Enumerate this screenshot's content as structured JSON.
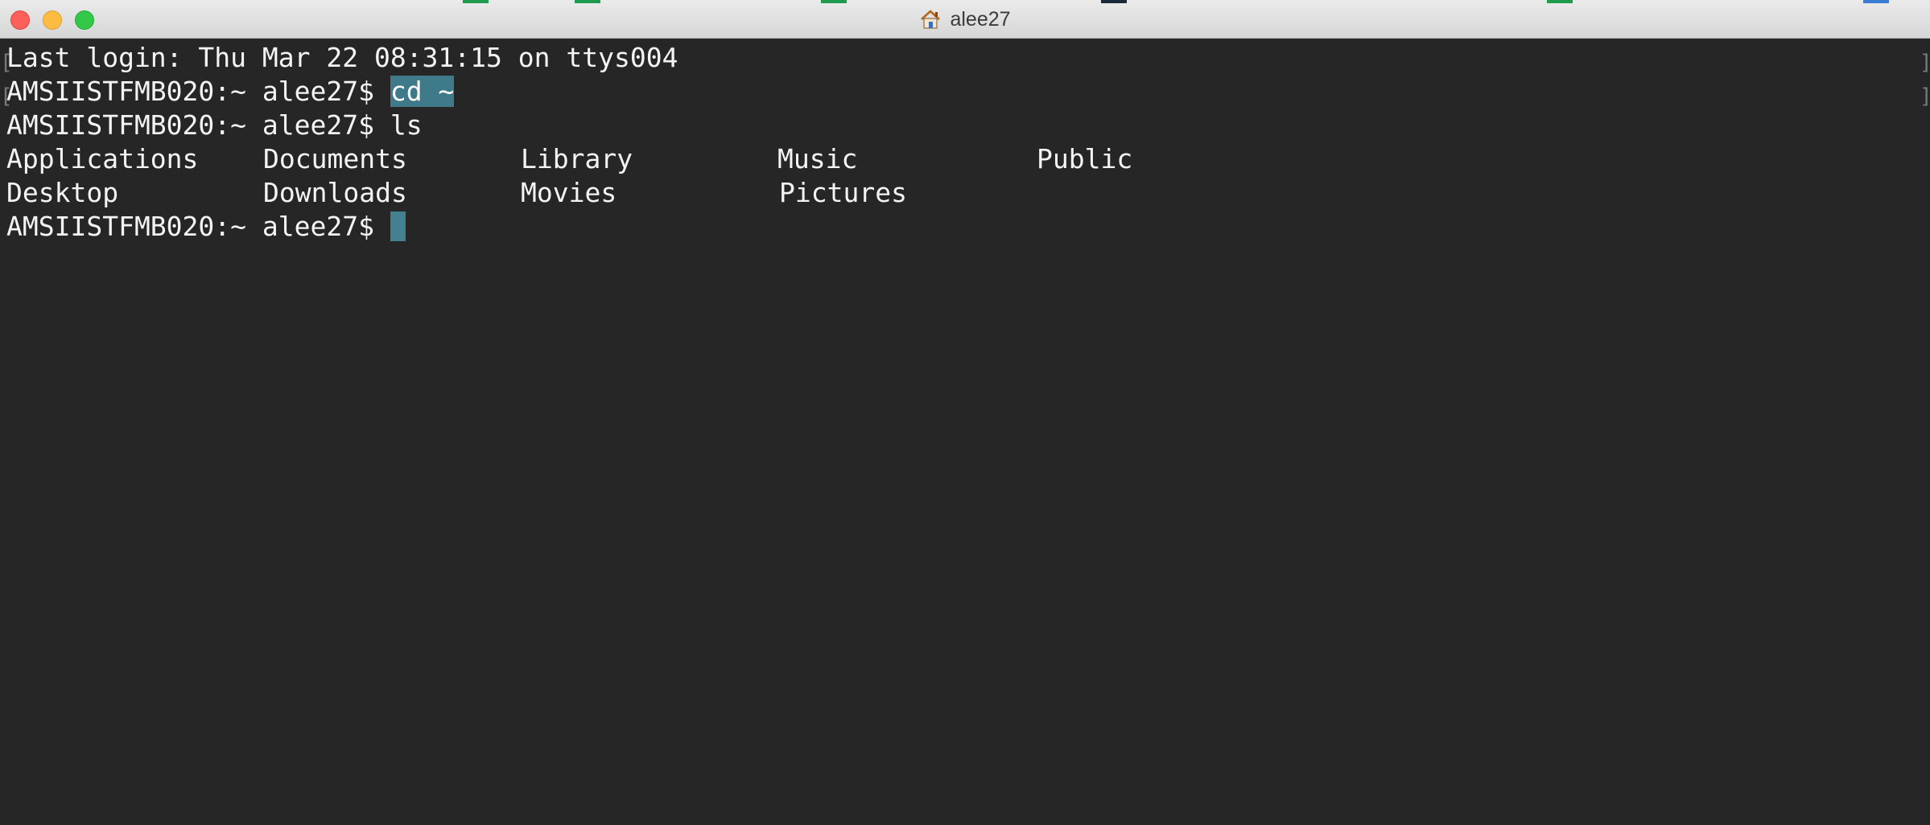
{
  "window": {
    "title": "alee27",
    "title_icon": "home-icon"
  },
  "terminal": {
    "last_login": "Last login: Thu Mar 22 08:31:15 on ttys004",
    "prompt": "AMSIISTFMB020:~ alee27$ ",
    "commands": [
      "cd ~",
      "ls"
    ],
    "ls_output": [
      "Applications",
      "Documents",
      "Library",
      "Music",
      "Public",
      "Desktop",
      "Downloads",
      "Movies",
      "Pictures"
    ],
    "selection_color": "#3f7a8a",
    "cursor_color": "#44808f",
    "background_color": "#262626",
    "text_color": "#f4f4f4"
  }
}
